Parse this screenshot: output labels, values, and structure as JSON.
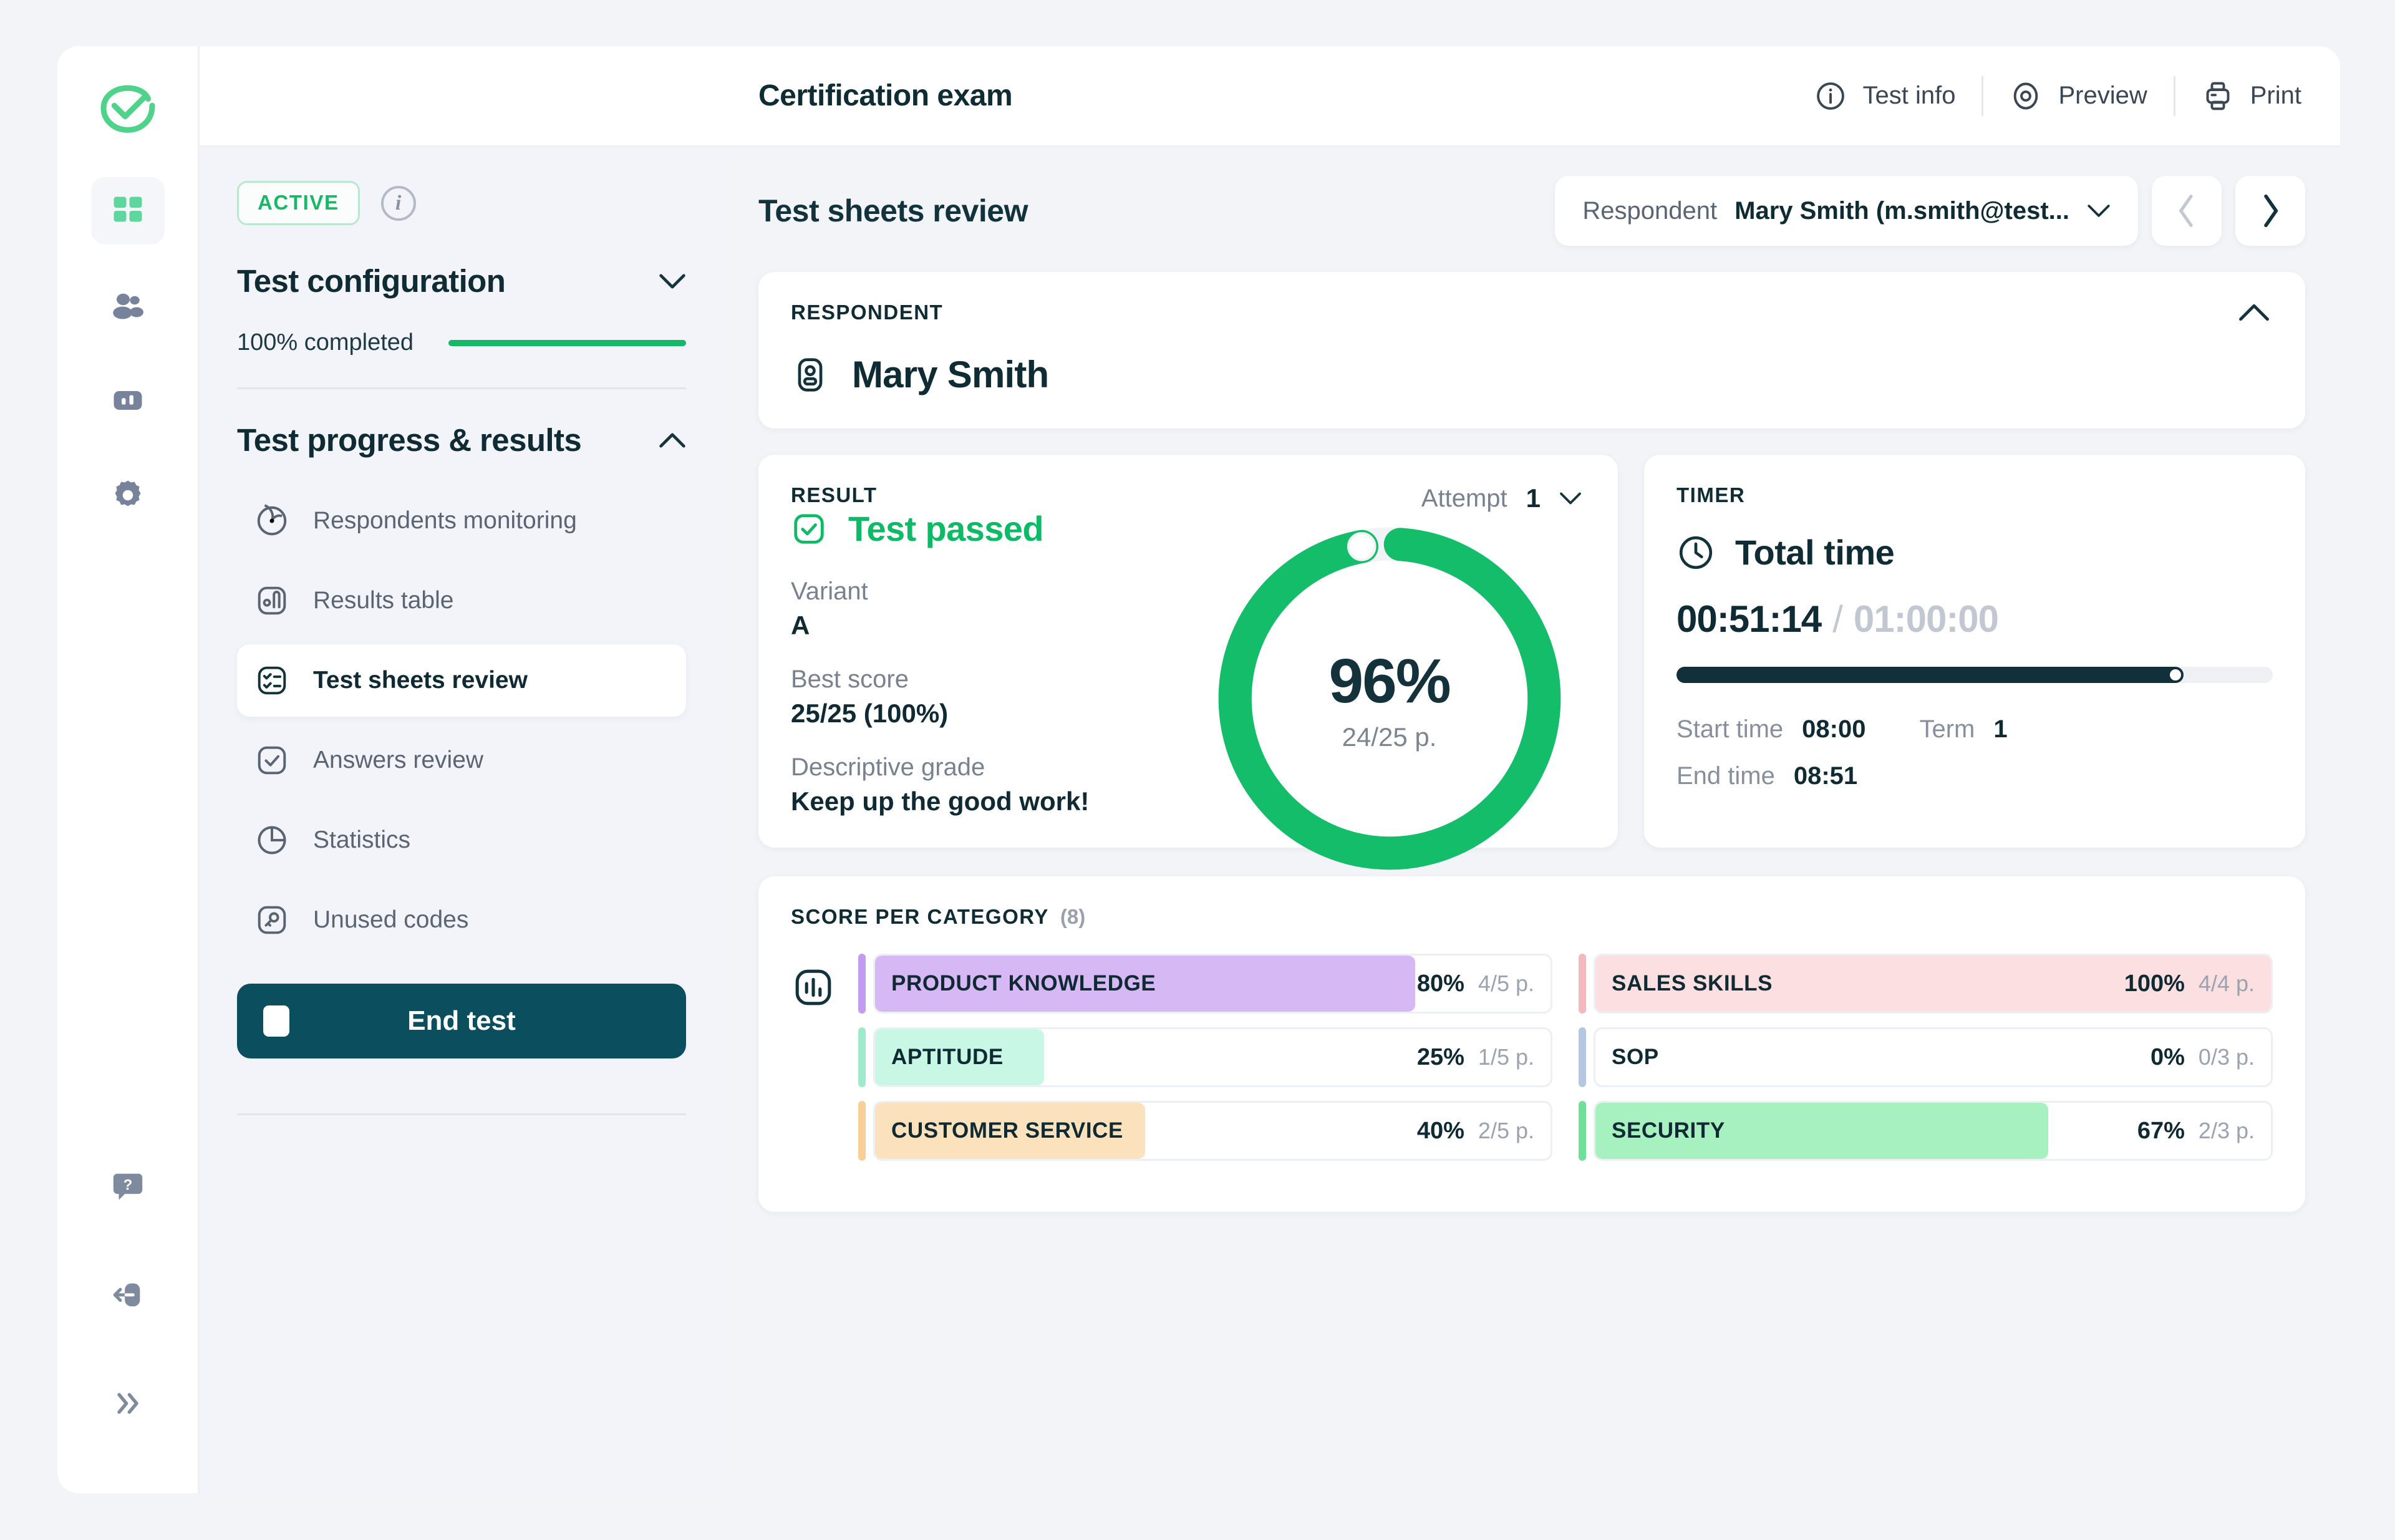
{
  "app": {
    "title": "Certification exam"
  },
  "topbar": {
    "actions": [
      {
        "label": "Test info",
        "icon": "info-circle-icon"
      },
      {
        "label": "Preview",
        "icon": "eye-target-icon"
      },
      {
        "label": "Print",
        "icon": "printer-icon"
      }
    ]
  },
  "rail": {
    "logo": "brand-check-logo",
    "items": [
      {
        "icon": "dashboard-grid-icon",
        "active": true
      },
      {
        "icon": "users-icon",
        "active": false
      },
      {
        "icon": "chart-bar-icon",
        "active": false
      },
      {
        "icon": "gear-icon",
        "active": false
      }
    ],
    "bottom": [
      {
        "icon": "help-bubble-icon"
      },
      {
        "icon": "logout-icon"
      },
      {
        "icon": "expand-chevrons-icon"
      }
    ]
  },
  "left_panel": {
    "status_badge": "ACTIVE",
    "info_icon": "info-circle-icon",
    "config": {
      "title": "Test configuration",
      "collapsed": true,
      "completed_label": "100% completed",
      "completed_percent": 100
    },
    "progress": {
      "title": "Test progress & results",
      "collapsed": false,
      "items": [
        {
          "label": "Respondents monitoring",
          "icon": "monitoring-icon",
          "selected": false
        },
        {
          "label": "Results table",
          "icon": "results-table-icon",
          "selected": false
        },
        {
          "label": "Test sheets review",
          "icon": "test-sheet-icon",
          "selected": true
        },
        {
          "label": "Answers review",
          "icon": "check-square-icon",
          "selected": false
        },
        {
          "label": "Statistics",
          "icon": "pie-chart-icon",
          "selected": false
        },
        {
          "label": "Unused codes",
          "icon": "key-icon",
          "selected": false
        }
      ]
    },
    "end_test_label": "End test"
  },
  "main": {
    "page_title": "Test sheets review",
    "respondent_selector": {
      "label": "Respondent",
      "value": "Mary Smith (m.smith@test...",
      "chevron": "chevron-down-icon"
    },
    "prev_label": "‹",
    "next_label": "›",
    "respondent_card": {
      "eyebrow": "RESPONDENT",
      "name": "Mary Smith",
      "avatar_icon": "person-badge-icon",
      "collapse_icon": "chevron-up-icon"
    },
    "result_card": {
      "eyebrow": "RESULT",
      "status": "Test passed",
      "status_icon": "check-square-green-icon",
      "attempt_label": "Attempt",
      "attempt_value": "1",
      "fields": [
        {
          "label": "Variant",
          "value": "A"
        },
        {
          "label": "Best score",
          "value": "25/25 (100%)"
        },
        {
          "label": "Descriptive grade",
          "value": "Keep up the good work!"
        }
      ],
      "donut": {
        "percent_label": "96%",
        "points_label": "24/25 p.",
        "percent": 96
      }
    },
    "timer_card": {
      "eyebrow": "TIMER",
      "title": "Total time",
      "clock_icon": "clock-icon",
      "elapsed": "00:51:14",
      "separator": "/",
      "total": "01:00:00",
      "progress_percent": 85,
      "meta": [
        {
          "label": "Start time",
          "value": "08:00"
        },
        {
          "label": "Term",
          "value": "1"
        },
        {
          "label": "End time",
          "value": "08:51"
        }
      ]
    },
    "score_card": {
      "eyebrow": "SCORE PER CATEGORY",
      "count": "(8)",
      "icon": "bar-chart-icon"
    }
  },
  "chart_data": {
    "type": "bar",
    "title": "SCORE PER CATEGORY",
    "orientation": "horizontal",
    "xlabel": "",
    "ylabel": "",
    "xlim": [
      0,
      100
    ],
    "grid": false,
    "legend": false,
    "categories": [
      "PRODUCT KNOWLEDGE",
      "APTITUDE",
      "CUSTOMER SERVICE",
      "SALES SKILLS",
      "SOP",
      "SECURITY"
    ],
    "values": [
      80,
      25,
      40,
      100,
      0,
      67
    ],
    "columns": [
      [
        {
          "name": "PRODUCT KNOWLEDGE",
          "percent": 80,
          "percent_label": "80%",
          "points_label": "4/5 p.",
          "scored": 4,
          "max": 5,
          "fill": "#d6b8f4",
          "strip": "#c09df0"
        },
        {
          "name": "APTITUDE",
          "percent": 25,
          "percent_label": "25%",
          "points_label": "1/5 p.",
          "scored": 1,
          "max": 5,
          "fill": "#c9f7e5",
          "strip": "#9fe9cd"
        },
        {
          "name": "CUSTOMER SERVICE",
          "percent": 40,
          "percent_label": "40%",
          "points_label": "2/5 p.",
          "scored": 2,
          "max": 5,
          "fill": "#fce2bc",
          "strip": "#f8cf97"
        }
      ],
      [
        {
          "name": "SALES SKILLS",
          "percent": 100,
          "percent_label": "100%",
          "points_label": "4/4 p.",
          "scored": 4,
          "max": 4,
          "fill": "#fcdfe1",
          "strip": "#f4b9bd"
        },
        {
          "name": "SOP",
          "percent": 0,
          "percent_label": "0%",
          "points_label": "0/3 p.",
          "scored": 0,
          "max": 3,
          "fill": "#dfe8f7",
          "strip": "#b6c7e4"
        },
        {
          "name": "SECURITY",
          "percent": 67,
          "percent_label": "67%",
          "points_label": "2/3 p.",
          "scored": 2,
          "max": 3,
          "fill": "#a7f0c0",
          "strip": "#6fe099"
        }
      ]
    ]
  },
  "colors": {
    "brand_green": "#14b866",
    "dark_teal": "#0b4e5e",
    "ink": "#0f2b33",
    "muted": "#78828f",
    "page_bg": "#f2f4f8"
  }
}
